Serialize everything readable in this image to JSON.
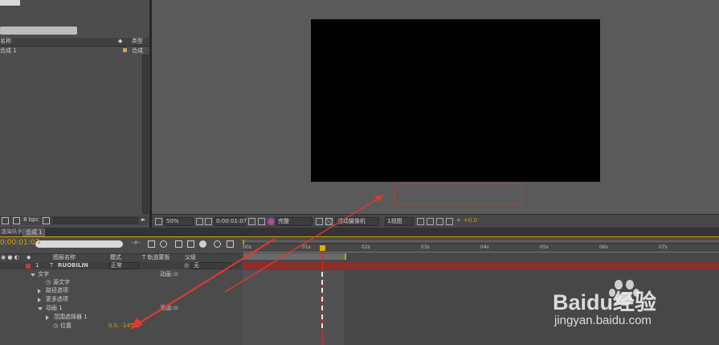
{
  "project": {
    "search_label": "",
    "col_name": "名称",
    "col_type": "类型",
    "item_name": "合成 1",
    "item_type": "合成"
  },
  "project_footer": {
    "bpc": "8 bpc"
  },
  "viewer_bar": {
    "zoom": "50%",
    "timecode": "0:00:01:07",
    "resolution": "完整",
    "view_mode": "活动摄像机",
    "views": "1视图",
    "exposure": "+0.0"
  },
  "tabs": {
    "render_queue": "渲染队列",
    "comp": "合成 1"
  },
  "timeline": {
    "current_time": "0:00:01:07",
    "search_placeholder": "",
    "col_layer_name": "图层名称",
    "col_mode": "模式",
    "col_trkmat": "T 轨道蒙板",
    "col_parent": "父级",
    "ruler": [
      "00s",
      "01s",
      "02s",
      "03s",
      "04s",
      "05s",
      "06s",
      "07s"
    ]
  },
  "layers": {
    "layer_num": "1",
    "layer_name": "RUOBILIN",
    "layer_mode": "正常",
    "layer_parent": "无",
    "text_group": "文字",
    "animate_label": "动画:",
    "source_text": "源文字",
    "path_options": "路径选项",
    "more_options": "更多选项",
    "animator": "动画 1",
    "add_label": "添加:",
    "range_selector": "范围选择器 1",
    "position": "位置",
    "position_value": "0.0, -145.0"
  },
  "watermark": {
    "brand": "Baidu经验",
    "url": "jingyan.baidu.com"
  },
  "colors": {
    "accent": "#d9a400",
    "arrow": "#e2392f",
    "layer_bar": "#8a2e2e",
    "canvas": "#000000"
  }
}
